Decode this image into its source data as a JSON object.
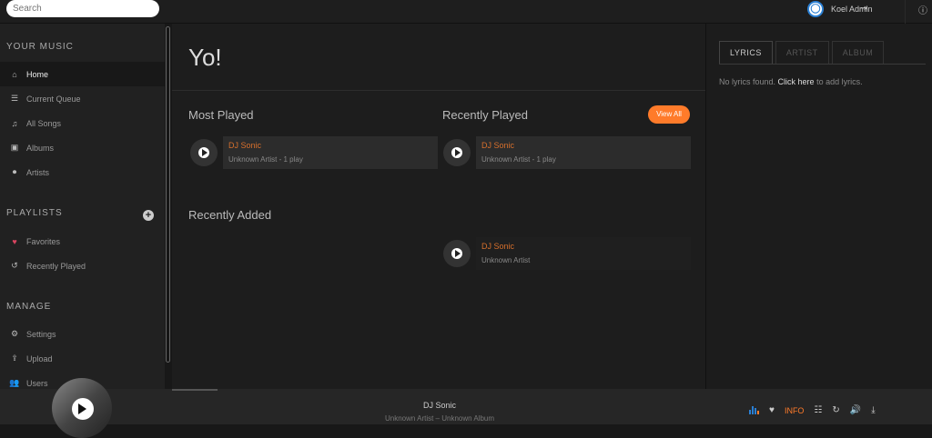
{
  "search": {
    "placeholder": "Search"
  },
  "user": {
    "name": "Koel Admin",
    "avatar_letter": "◯"
  },
  "sidebar": {
    "sections": {
      "your_music": "YOUR MUSIC",
      "playlists": "PLAYLISTS",
      "manage": "MANAGE"
    },
    "music_items": [
      {
        "label": "Home",
        "icon": "home-icon",
        "glyph": "⌂"
      },
      {
        "label": "Current Queue",
        "icon": "list-icon",
        "glyph": "☰"
      },
      {
        "label": "All Songs",
        "icon": "music-note-icon",
        "glyph": "♫"
      },
      {
        "label": "Albums",
        "icon": "album-icon",
        "glyph": "▣"
      },
      {
        "label": "Artists",
        "icon": "microphone-icon",
        "glyph": "⏺"
      }
    ],
    "playlist_items": [
      {
        "label": "Favorites",
        "icon": "heart-icon",
        "glyph": "♥"
      },
      {
        "label": "Recently Played",
        "icon": "history-icon",
        "glyph": "↺"
      }
    ],
    "manage_items": [
      {
        "label": "Settings",
        "icon": "gear-icon",
        "glyph": "⚙"
      },
      {
        "label": "Upload",
        "icon": "upload-icon",
        "glyph": "⇪"
      },
      {
        "label": "Users",
        "icon": "users-icon",
        "glyph": "👥"
      }
    ],
    "add_playlist": "+"
  },
  "main": {
    "heading": "Yo!",
    "most_played": {
      "title": "Most Played",
      "songs": [
        {
          "title": "DJ Sonic",
          "sub": "Unknown Artist - 1 play"
        }
      ]
    },
    "recently_played": {
      "title": "Recently Played",
      "view_all": "View All",
      "songs": [
        {
          "title": "DJ Sonic",
          "sub": "Unknown Artist - 1 play"
        }
      ]
    },
    "recently_added": {
      "title": "Recently Added",
      "songs": [
        {
          "title": "DJ Sonic",
          "sub": "Unknown Artist"
        }
      ]
    }
  },
  "right": {
    "tabs": [
      "LYRICS",
      "ARTIST",
      "ALBUM"
    ],
    "lyrics_msg_prefix": "No lyrics found.",
    "lyrics_msg_link": "Click here",
    "lyrics_msg_suffix": "to add lyrics."
  },
  "player": {
    "title": "DJ Sonic",
    "subtitle": "Unknown Artist – Unknown Album",
    "info_label": "INFO",
    "controls": {
      "like": "♥",
      "eq": "☷",
      "repeat": "↻",
      "volume": "🔊",
      "download": "⤓"
    }
  },
  "colors": {
    "accent": "#ff7b2a",
    "song_title": "#d66f2c",
    "avatar_ring": "#2a7fd3"
  }
}
